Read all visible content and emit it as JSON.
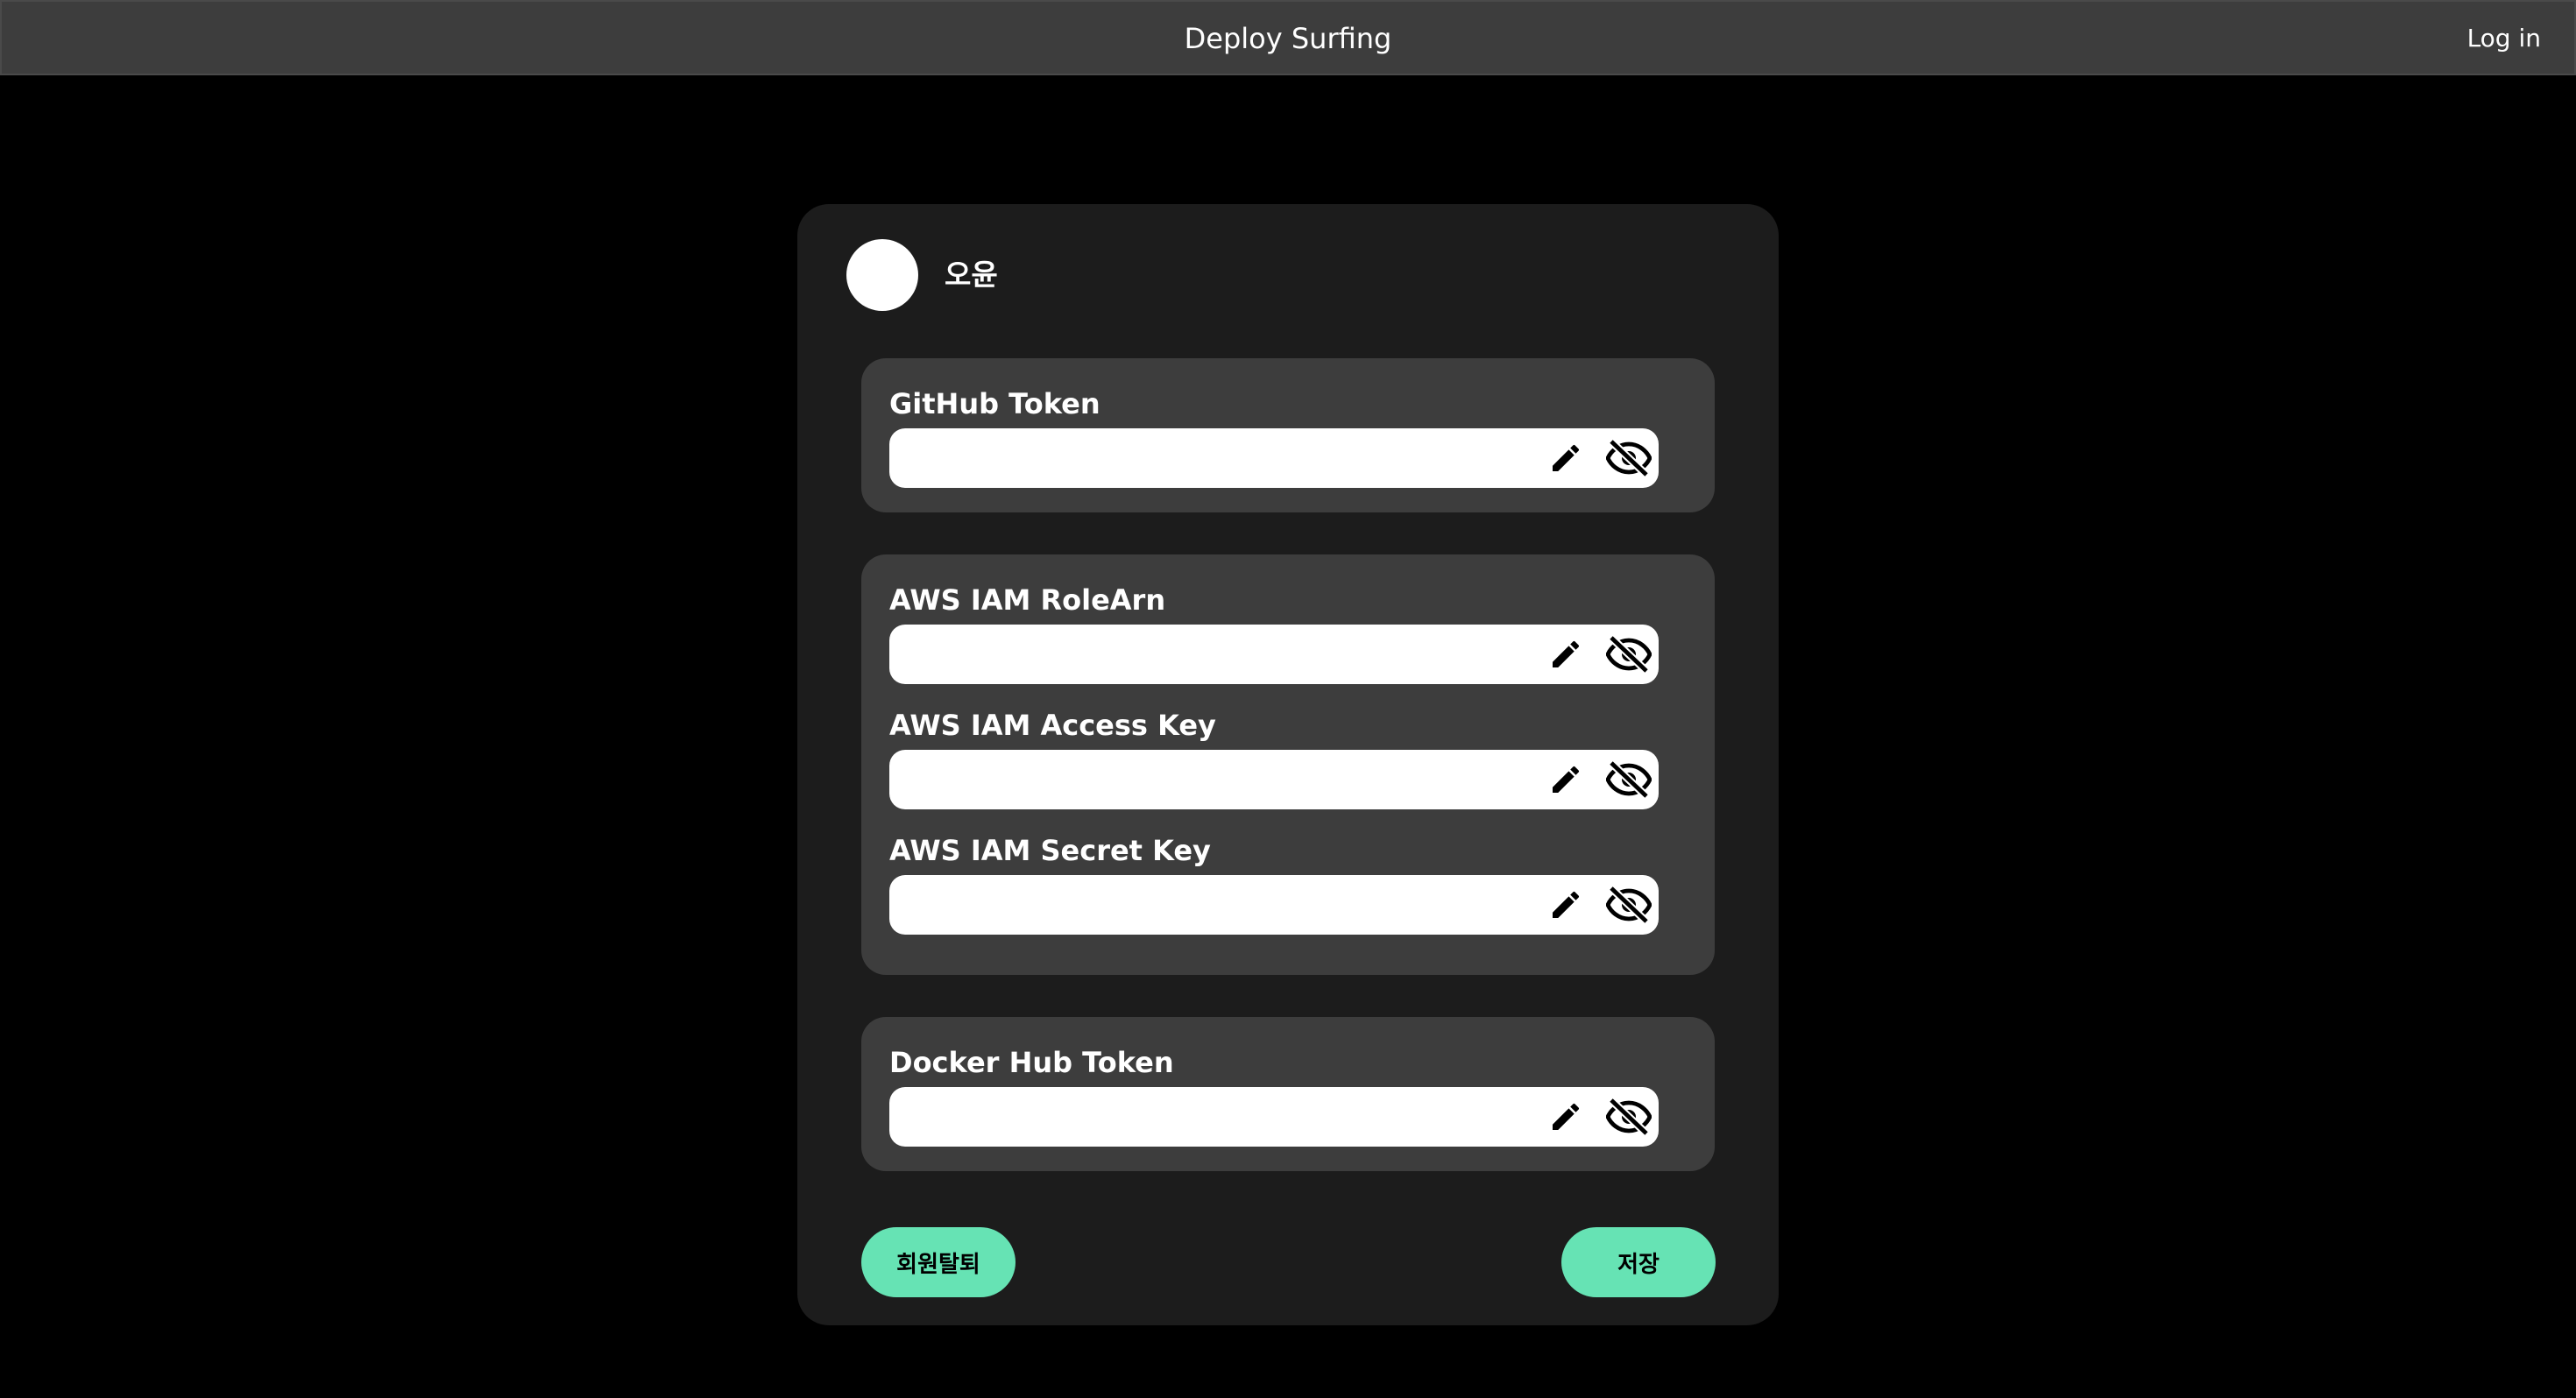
{
  "header": {
    "title": "Deploy Surfing",
    "login_label": "Log in"
  },
  "profile": {
    "username": "오윤"
  },
  "sections": {
    "github": {
      "fields": [
        {
          "label": "GitHub Token",
          "value": ""
        }
      ]
    },
    "aws": {
      "fields": [
        {
          "label": "AWS IAM RoleArn",
          "value": ""
        },
        {
          "label": "AWS IAM Access Key",
          "value": ""
        },
        {
          "label": "AWS IAM Secret Key",
          "value": ""
        }
      ]
    },
    "docker": {
      "fields": [
        {
          "label": "Docker Hub Token",
          "value": ""
        }
      ]
    }
  },
  "icons": {
    "edit": "pencil-icon",
    "visibility": "eye-off-icon"
  },
  "actions": {
    "withdraw_label": "회원탈퇴",
    "save_label": "저장"
  },
  "colors": {
    "background": "#000000",
    "topbar": "#3d3d3d",
    "card": "#1c1c1c",
    "section": "#3d3d3d",
    "accent": "#66e3b4"
  }
}
